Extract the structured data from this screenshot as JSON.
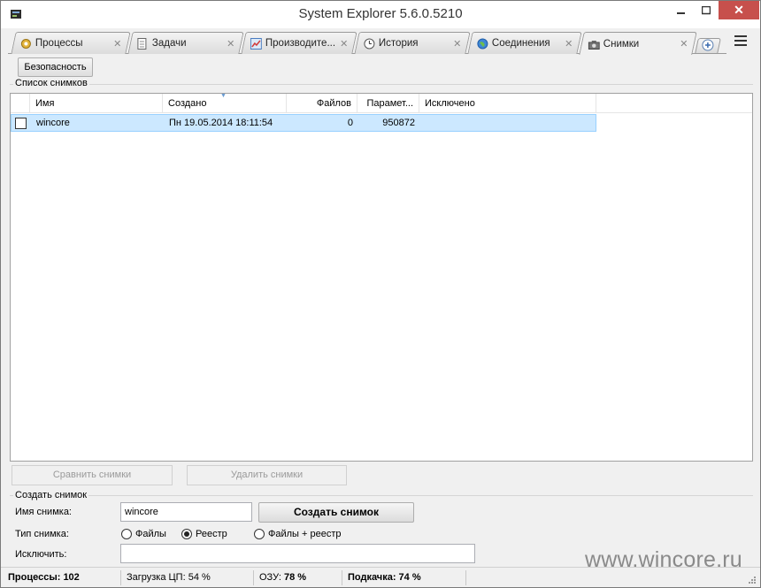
{
  "window": {
    "title": "System Explorer 5.6.0.5210"
  },
  "tabs": [
    {
      "label": "Процессы",
      "icon": "gear-icon"
    },
    {
      "label": "Задачи",
      "icon": "document-icon"
    },
    {
      "label": "Производите...",
      "icon": "performance-icon"
    },
    {
      "label": "История",
      "icon": "clock-icon"
    },
    {
      "label": "Соединения",
      "icon": "globe-icon"
    },
    {
      "label": "Снимки",
      "icon": "camera-icon",
      "active": true
    }
  ],
  "toolbar": {
    "security_label": "Безопасность"
  },
  "snapshot_list": {
    "caption": "Список снимков",
    "columns": [
      "Имя",
      "Создано",
      "Файлов",
      "Парамет...",
      "Исключено"
    ],
    "rows": [
      {
        "name": "wincore",
        "created": "Пн 19.05.2014 18:11:54",
        "files": "0",
        "params": "950872",
        "excluded": ""
      }
    ]
  },
  "actions": {
    "compare_label": "Сравнить снимки",
    "delete_label": "Удалить снимки"
  },
  "create": {
    "caption": "Создать снимок",
    "name_label": "Имя снимка:",
    "name_value": "wincore",
    "create_button": "Создать снимок",
    "type_label": "Тип снимка:",
    "type_options": [
      "Файлы",
      "Реестр",
      "Файлы + реестр"
    ],
    "type_selected": "Реестр",
    "exclude_label": "Исключить:",
    "exclude_value": ""
  },
  "status": {
    "processes_label": "Процессы:",
    "processes_value": "102",
    "cpu_label": "Загрузка ЦП:",
    "cpu_value": "54 %",
    "ram_label": "ОЗУ:",
    "ram_value": "78 %",
    "swap_label": "Подкачка:",
    "swap_value": "74 %"
  },
  "watermark": "www.wincore.ru"
}
